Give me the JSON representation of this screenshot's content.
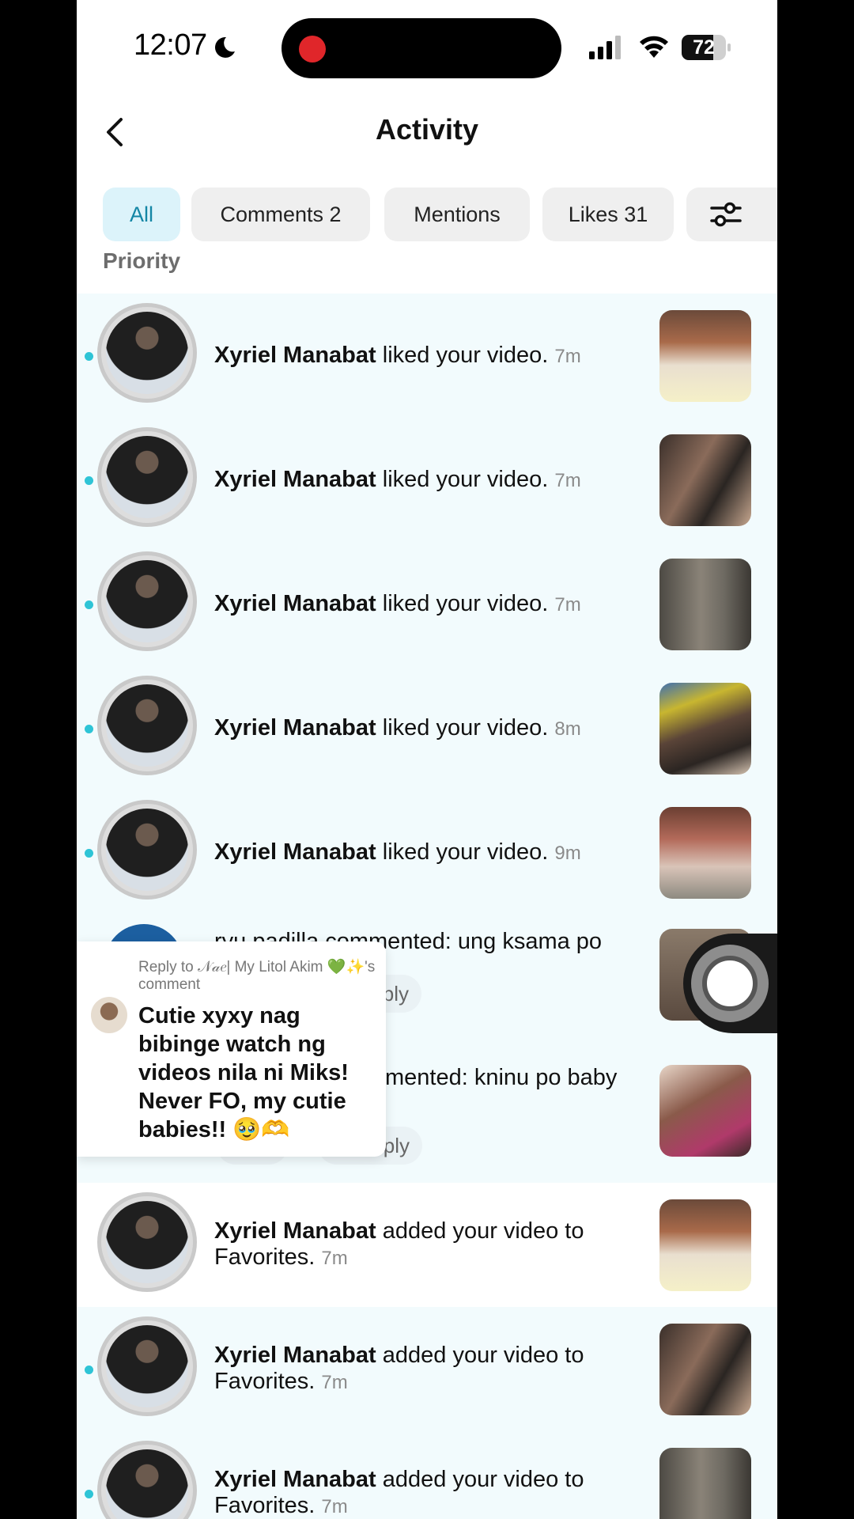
{
  "status_bar": {
    "time": "12:07",
    "battery": "72",
    "battery_level": 0.72
  },
  "header": {
    "title": "Activity",
    "back_icon": "chevron-left-icon"
  },
  "tabs": [
    {
      "label": "All",
      "active": true
    },
    {
      "label": "Comments 2",
      "active": false
    },
    {
      "label": "Mentions",
      "active": false
    },
    {
      "label": "Likes 31",
      "active": false
    }
  ],
  "section_label": "Priority",
  "like_rows": [
    {
      "user": "Xyriel Manabat",
      "action": "liked your video.",
      "time": "7m",
      "unread": true
    },
    {
      "user": "Xyriel Manabat",
      "action": "liked your video.",
      "time": "7m",
      "unread": true
    },
    {
      "user": "Xyriel Manabat",
      "action": "liked your video.",
      "time": "7m",
      "unread": true
    },
    {
      "user": "Xyriel Manabat",
      "action": "liked your video.",
      "time": "8m",
      "unread": true
    },
    {
      "user": "Xyriel Manabat",
      "action": "liked your video.",
      "time": "9m",
      "unread": true
    }
  ],
  "comment_rows": [
    {
      "text": "ryu padilla commented: ung ksama po",
      "reply_label": "ply"
    },
    {
      "text": "mented: kninu po baby",
      "reply_label": "ply"
    }
  ],
  "overlay": {
    "subtitle": "Reply to 𝒩𝒶𝑒| My Litol Akim 💚✨'s comment",
    "body": "Cutie xyxy nag bibinge watch ng videos nila ni Miks! Never FO, my cutie babies!! 🥹🫶"
  },
  "fav_rows": [
    {
      "user": "Xyriel Manabat",
      "action": "added your video to Favorites.",
      "time": "7m",
      "unread": false
    },
    {
      "user": "Xyriel Manabat",
      "action": "added your video to Favorites.",
      "time": "7m",
      "unread": true
    },
    {
      "user": "Xyriel Manabat",
      "action": "added your video to Favorites.",
      "time": "7m",
      "unread": true
    }
  ],
  "colors": {
    "accent": "#2ec4d6",
    "tab_active_bg": "#dcf3fa",
    "tab_active_text": "#1386a5",
    "row_bg": "#f2fbfd",
    "record": "#e0262a"
  }
}
